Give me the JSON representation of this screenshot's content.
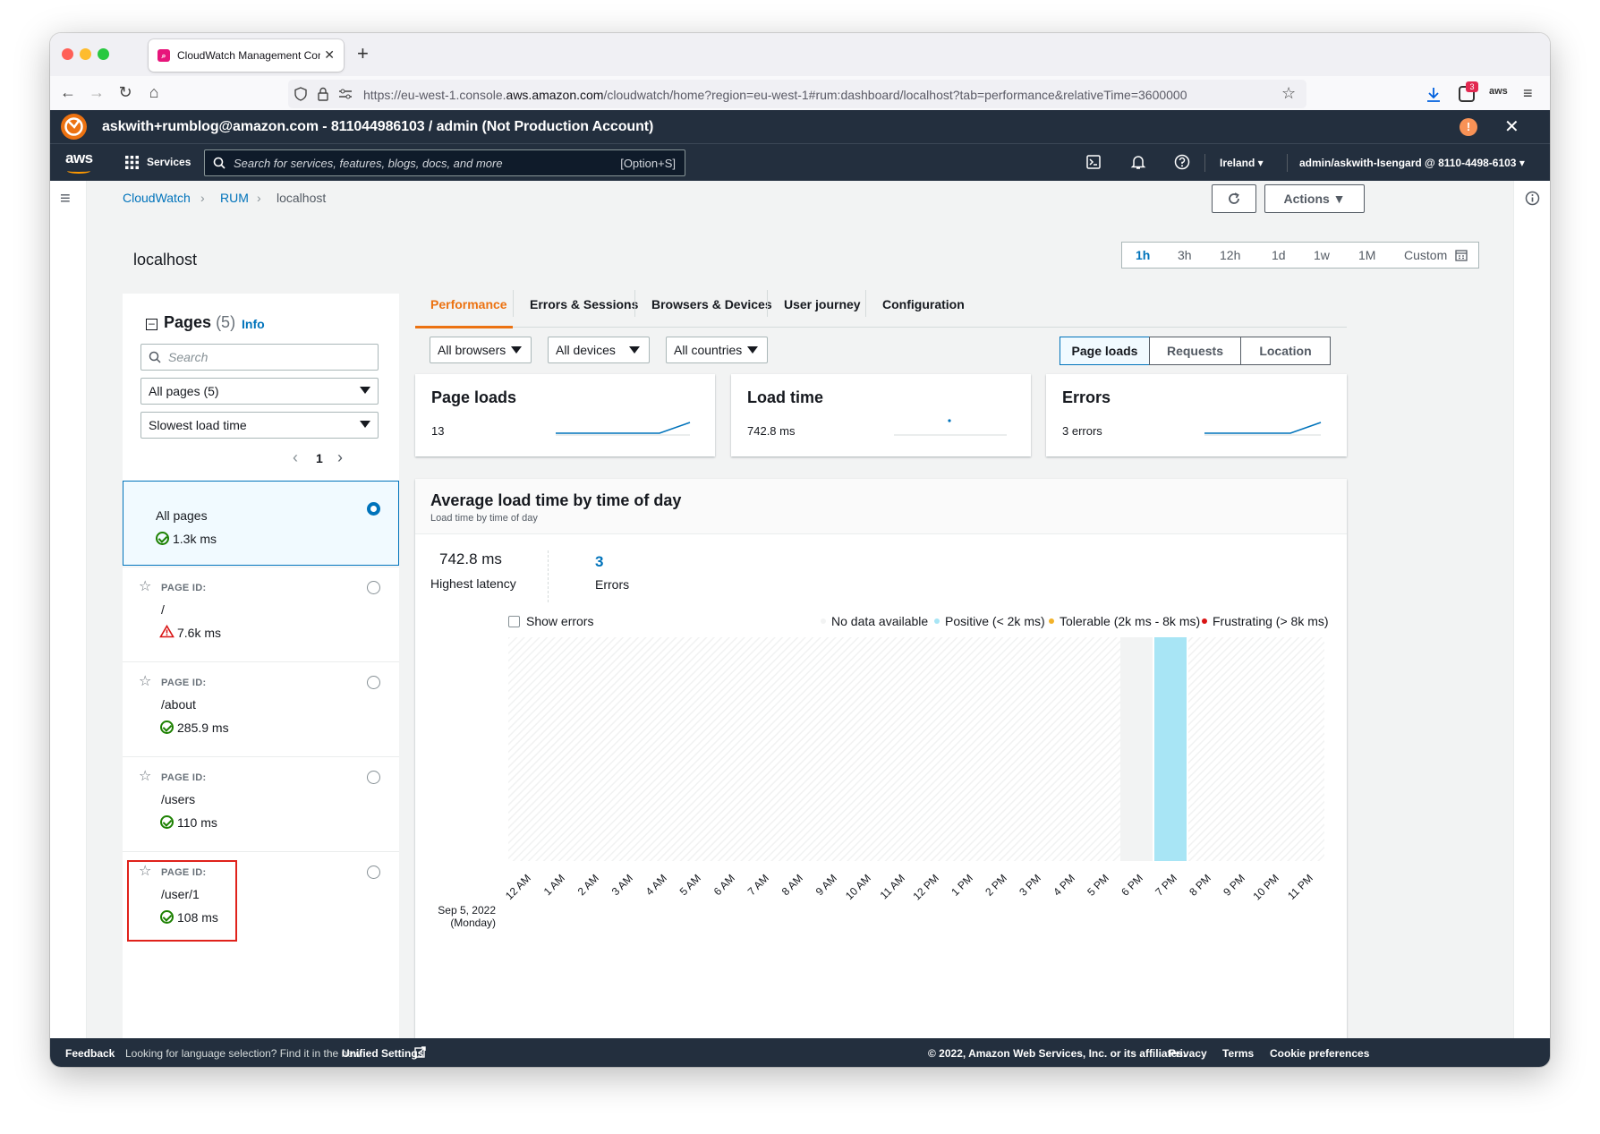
{
  "browser": {
    "tab_title": "CloudWatch Management Cons",
    "url_prefix": "https://eu-west-1.console.",
    "url_domain": "aws.amazon.com",
    "url_path": "/cloudwatch/home?region=eu-west-1#rum:dashboard/localhost?tab=performance&relativeTime=3600000",
    "notif_count": "3"
  },
  "banner": {
    "text": "askwith+rumblog@amazon.com - 811044986103 / admin (Not Production Account)"
  },
  "header": {
    "logo": "aws",
    "services": "Services",
    "search_placeholder": "Search for services, features, blogs, docs, and more",
    "search_shortcut": "[Option+S]",
    "region": "Ireland ▾",
    "account": "admin/askwith-Isengard @ 8110-4498-6103 ▾"
  },
  "breadcrumb": {
    "cloudwatch": "CloudWatch",
    "rum": "RUM",
    "current": "localhost"
  },
  "actions_label": "Actions ▼",
  "page_title": "localhost",
  "time_range": {
    "options": [
      "1h",
      "3h",
      "12h",
      "1d",
      "1w",
      "1M",
      "Custom"
    ],
    "selected": "1h"
  },
  "pages_panel": {
    "title": "Pages",
    "count": "(5)",
    "info": "Info",
    "search_placeholder": "Search",
    "filter": "All pages (5)",
    "sort": "Slowest load time",
    "page_number": "1",
    "all_pages": {
      "label": "All pages",
      "time": "1.3k ms"
    },
    "page_id_label": "PAGE ID:",
    "items": [
      {
        "path": "/",
        "time": "7.6k ms",
        "status": "warning"
      },
      {
        "path": "/about",
        "time": "285.9 ms",
        "status": "ok"
      },
      {
        "path": "/users",
        "time": "110 ms",
        "status": "ok"
      },
      {
        "path": "/user/1",
        "time": "108 ms",
        "status": "ok"
      }
    ]
  },
  "tabs": [
    "Performance",
    "Errors & Sessions",
    "Browsers & Devices",
    "User journey",
    "Configuration"
  ],
  "filters": {
    "browsers": "All browsers",
    "devices": "All devices",
    "countries": "All countries"
  },
  "view_toggle": {
    "options": [
      "Page loads",
      "Requests",
      "Location"
    ],
    "selected": "Page loads"
  },
  "kpis": [
    {
      "title": "Page loads",
      "value": "13"
    },
    {
      "title": "Load time",
      "value": "742.8 ms"
    },
    {
      "title": "Errors",
      "value": "3 errors"
    }
  ],
  "load_chart": {
    "title": "Average load time by time of day",
    "subtitle": "Load time by time of day",
    "highest_latency_value": "742.8 ms",
    "highest_latency_label": "Highest latency",
    "errors_value": "3",
    "errors_label": "Errors",
    "show_errors": "Show errors",
    "legend": [
      {
        "label": "No data available",
        "color": "#f2f3f3"
      },
      {
        "label": "Positive (< 2k ms)",
        "color": "#a8e5f5"
      },
      {
        "label": "Tolerable (2k ms - 8k ms)",
        "color": "#f2b22a"
      },
      {
        "label": "Frustrating (> 8k ms)",
        "color": "#d91515"
      }
    ],
    "row_date": "Sep 5, 2022",
    "row_day": "(Monday)"
  },
  "chart_data": {
    "type": "heatmap",
    "title": "Average load time by time of day",
    "categories": [
      "12 AM",
      "1 AM",
      "2 AM",
      "3 AM",
      "4 AM",
      "5 AM",
      "6 AM",
      "7 AM",
      "8 AM",
      "9 AM",
      "10 AM",
      "11 AM",
      "12 PM",
      "1 PM",
      "2 PM",
      "3 PM",
      "4 PM",
      "5 PM",
      "6 PM",
      "7 PM",
      "8 PM",
      "9 PM",
      "10 PM",
      "11 PM"
    ],
    "rows": [
      "Sep 5, 2022 (Monday)"
    ],
    "cells": [
      {
        "hour": "6 PM",
        "status": "no-data"
      },
      {
        "hour": "7 PM",
        "status": "positive"
      }
    ],
    "legend_position": "top-right"
  },
  "footer": {
    "feedback": "Feedback",
    "lang": "Looking for language selection? Find it in the new",
    "unified": "Unified Settings",
    "copyright": "© 2022, Amazon Web Services, Inc. or its affiliates.",
    "privacy": "Privacy",
    "terms": "Terms",
    "cookies": "Cookie preferences"
  }
}
